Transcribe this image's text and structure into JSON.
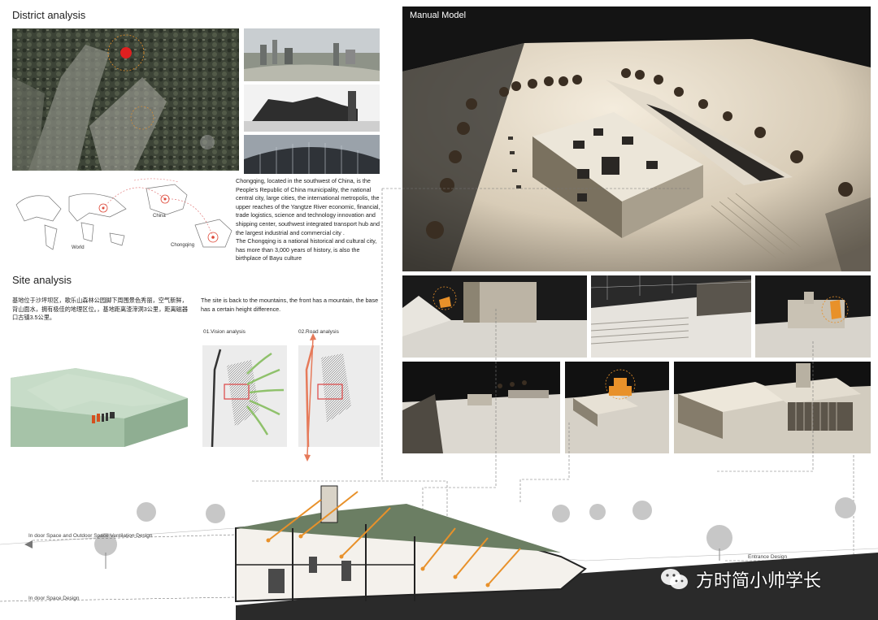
{
  "district": {
    "title": "District analysis",
    "map_labels": {
      "world": "World",
      "china": "China",
      "chongqing": "Chongqing"
    },
    "description_1": "Chongqing, located in the southwest of China, is the People's Republic of China municipality, the national central city, large cities, the international metropolis, the upper reaches of the Yangtze River economic, financial, trade logistics, science and technology innovation and shipping center, southwest integrated transport hub and the largest industrial and commercial city .",
    "description_2": "The Chongqing is a national historical and cultural city, has more than 3,000 years of history, is also the birthplace of Bayu culture"
  },
  "site": {
    "title": "Site analysis",
    "chinese_text": "基地位于沙坪坝区，歌乐山森林公园脚下周围景色秀丽，空气新鲜，背山面水，拥有极佳的地理区位。，基地距离渣滓洞3公里，距离磁器口古镇3.5公里。",
    "english_text": "The site is back to the mountains, the front has a mountain, the base has a certain height difference.",
    "vision_label": "01.Vision analysis",
    "road_label": "02.Road analysis"
  },
  "model": {
    "title": "Manual Model"
  },
  "section": {
    "ventilation_label": "In door Space and Outdoor Space Ventilation Design",
    "indoor_label": "In door Space Design",
    "entrance_label": "Entrance Design"
  },
  "watermark": {
    "text": "方时简小帅学长",
    "icon": "wechat-icon"
  },
  "colors": {
    "accent_orange": "#e8912a",
    "dark_bg": "#141414",
    "model_floor": "#d9cfc0",
    "terrain_green": "#b9d1bc"
  }
}
